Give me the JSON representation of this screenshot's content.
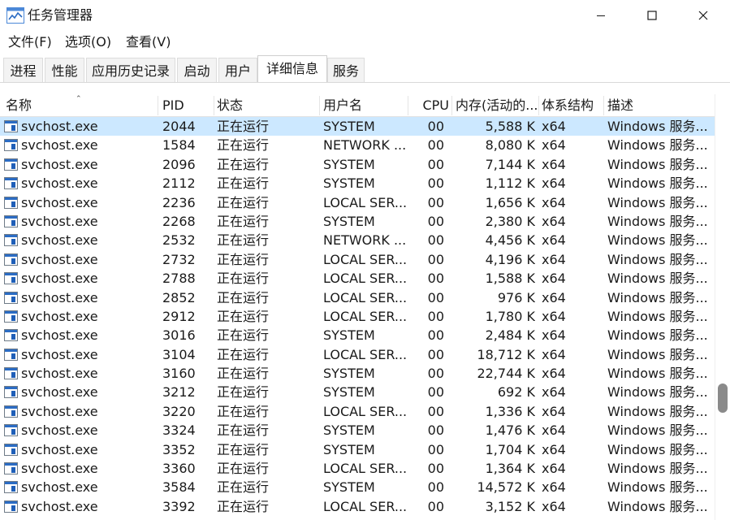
{
  "window": {
    "title": "任务管理器",
    "icon": "task-manager-icon"
  },
  "menu": [
    "文件(F)",
    "选项(O)",
    "查看(V)"
  ],
  "tabs": [
    {
      "label": "进程",
      "active": false
    },
    {
      "label": "性能",
      "active": false
    },
    {
      "label": "应用历史记录",
      "active": false
    },
    {
      "label": "启动",
      "active": false
    },
    {
      "label": "用户",
      "active": false
    },
    {
      "label": "详细信息",
      "active": true
    },
    {
      "label": "服务",
      "active": false
    }
  ],
  "table": {
    "columns": [
      "名称",
      "PID",
      "状态",
      "用户名",
      "CPU",
      "内存(活动的...",
      "体系结构",
      "描述"
    ],
    "sort": {
      "column": "名称",
      "direction": "ascending"
    },
    "selected_row": 0,
    "rows": [
      [
        "svchost.exe",
        "2044",
        "正在运行",
        "SYSTEM",
        "00",
        "5,588 K",
        "x64",
        "Windows 服务..."
      ],
      [
        "svchost.exe",
        "1584",
        "正在运行",
        "NETWORK ...",
        "00",
        "8,080 K",
        "x64",
        "Windows 服务..."
      ],
      [
        "svchost.exe",
        "2096",
        "正在运行",
        "SYSTEM",
        "00",
        "7,144 K",
        "x64",
        "Windows 服务..."
      ],
      [
        "svchost.exe",
        "2112",
        "正在运行",
        "SYSTEM",
        "00",
        "1,112 K",
        "x64",
        "Windows 服务..."
      ],
      [
        "svchost.exe",
        "2236",
        "正在运行",
        "LOCAL SER...",
        "00",
        "1,656 K",
        "x64",
        "Windows 服务..."
      ],
      [
        "svchost.exe",
        "2268",
        "正在运行",
        "SYSTEM",
        "00",
        "2,380 K",
        "x64",
        "Windows 服务..."
      ],
      [
        "svchost.exe",
        "2532",
        "正在运行",
        "NETWORK ...",
        "00",
        "4,456 K",
        "x64",
        "Windows 服务..."
      ],
      [
        "svchost.exe",
        "2732",
        "正在运行",
        "LOCAL SER...",
        "00",
        "4,196 K",
        "x64",
        "Windows 服务..."
      ],
      [
        "svchost.exe",
        "2788",
        "正在运行",
        "LOCAL SER...",
        "00",
        "1,588 K",
        "x64",
        "Windows 服务..."
      ],
      [
        "svchost.exe",
        "2852",
        "正在运行",
        "LOCAL SER...",
        "00",
        "976 K",
        "x64",
        "Windows 服务..."
      ],
      [
        "svchost.exe",
        "2912",
        "正在运行",
        "LOCAL SER...",
        "00",
        "1,780 K",
        "x64",
        "Windows 服务..."
      ],
      [
        "svchost.exe",
        "3016",
        "正在运行",
        "SYSTEM",
        "00",
        "2,484 K",
        "x64",
        "Windows 服务..."
      ],
      [
        "svchost.exe",
        "3104",
        "正在运行",
        "LOCAL SER...",
        "00",
        "18,712 K",
        "x64",
        "Windows 服务..."
      ],
      [
        "svchost.exe",
        "3160",
        "正在运行",
        "SYSTEM",
        "00",
        "22,744 K",
        "x64",
        "Windows 服务..."
      ],
      [
        "svchost.exe",
        "3212",
        "正在运行",
        "SYSTEM",
        "00",
        "692 K",
        "x64",
        "Windows 服务..."
      ],
      [
        "svchost.exe",
        "3220",
        "正在运行",
        "LOCAL SER...",
        "00",
        "1,336 K",
        "x64",
        "Windows 服务..."
      ],
      [
        "svchost.exe",
        "3324",
        "正在运行",
        "SYSTEM",
        "00",
        "1,476 K",
        "x64",
        "Windows 服务..."
      ],
      [
        "svchost.exe",
        "3352",
        "正在运行",
        "SYSTEM",
        "00",
        "1,704 K",
        "x64",
        "Windows 服务..."
      ],
      [
        "svchost.exe",
        "3360",
        "正在运行",
        "LOCAL SER...",
        "00",
        "1,364 K",
        "x64",
        "Windows 服务..."
      ],
      [
        "svchost.exe",
        "3584",
        "正在运行",
        "SYSTEM",
        "00",
        "14,572 K",
        "x64",
        "Windows 服务..."
      ],
      [
        "svchost.exe",
        "3392",
        "正在运行",
        "LOCAL SER...",
        "00",
        "3,152 K",
        "x64",
        "Windows 服务..."
      ]
    ]
  },
  "scrollbar": {
    "position": 0.72
  },
  "colors": {
    "selection": "#cce8ff",
    "accent": "#2b6cc4",
    "scroll_thumb": "#8a8a8a"
  }
}
